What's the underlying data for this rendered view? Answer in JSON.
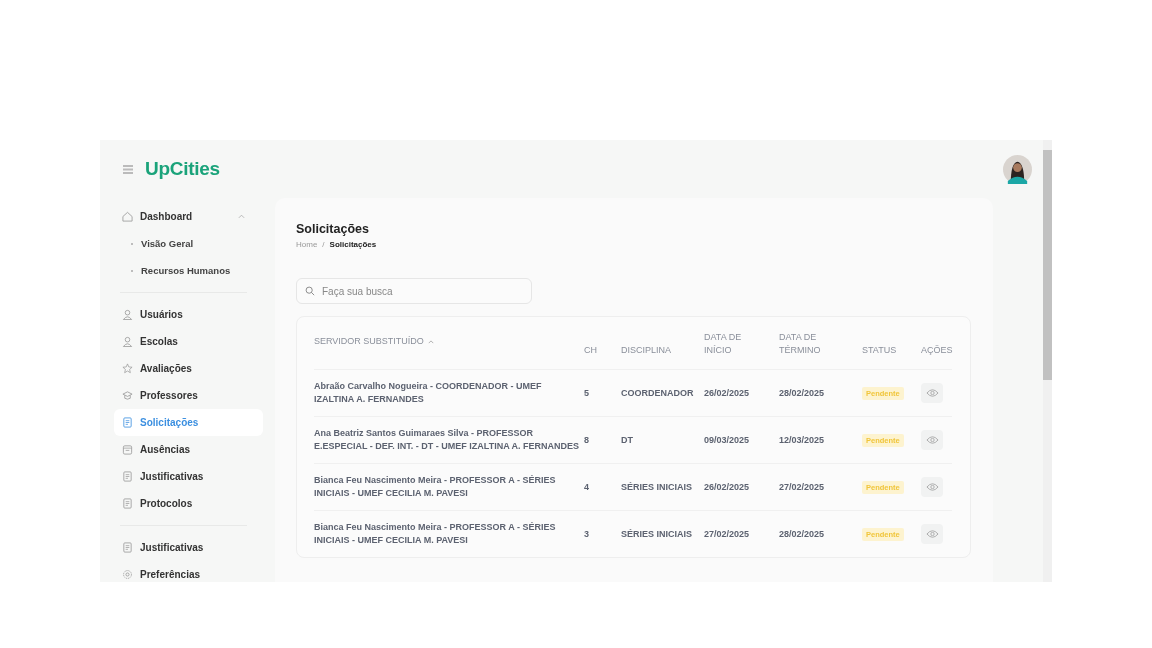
{
  "brand": "UpCities",
  "sidebar": {
    "sections": [
      [
        {
          "label": "Dashboard",
          "selected": false,
          "expanded": true,
          "children": [
            {
              "label": "Visão Geral",
              "selected": false
            },
            {
              "label": "Recursos Humanos",
              "selected": false
            }
          ]
        }
      ],
      [
        {
          "label": "Usuários",
          "selected": false
        },
        {
          "label": "Escolas",
          "selected": false
        },
        {
          "label": "Avaliações",
          "selected": false
        },
        {
          "label": "Professores",
          "selected": false
        },
        {
          "label": "Solicitações",
          "selected": true
        },
        {
          "label": "Ausências",
          "selected": false
        },
        {
          "label": "Justificativas",
          "selected": false
        },
        {
          "label": "Protocolos",
          "selected": false
        }
      ],
      [
        {
          "label": "Justificativas",
          "selected": false
        },
        {
          "label": "Preferências",
          "selected": false
        }
      ]
    ]
  },
  "page": {
    "title": "Solicitações",
    "breadcrumb": [
      "Home",
      "Solicitações"
    ],
    "breadcrumb_separator": "/"
  },
  "search": {
    "placeholder": "Faça sua busca"
  },
  "table": {
    "columns": [
      {
        "label": "SERVIDOR SUBSTITUÍDO",
        "sorted": true
      },
      {
        "label": "CH",
        "sorted": false
      },
      {
        "label": "DISCIPLINA",
        "sorted": false
      },
      {
        "label": "DATA DE INÍCIO",
        "sorted": false
      },
      {
        "label": "DATA DE TÉRMINO",
        "sorted": false
      },
      {
        "label": "STATUS",
        "sorted": false
      },
      {
        "label": "AÇÕES",
        "sorted": false
      }
    ],
    "rows": [
      {
        "servidor": "Abraão Carvalho Nogueira - COORDENADOR - UMEF IZALTINA A. FERNANDES",
        "ch": "5",
        "disciplina": "COORDENADOR",
        "inicio": "26/02/2025",
        "termino": "28/02/2025",
        "status": "Pendente"
      },
      {
        "servidor": "Ana Beatriz Santos Guimaraes Silva - PROFESSOR E.ESPECIAL - DEF. INT. - DT - UMEF IZALTINA A. FERNANDES",
        "ch": "8",
        "disciplina": "DT",
        "inicio": "09/03/2025",
        "termino": "12/03/2025",
        "status": "Pendente"
      },
      {
        "servidor": "Bianca Feu Nascimento Meira - PROFESSOR A - SÉRIES INICIAIS - UMEF CECILIA M. PAVESI",
        "ch": "4",
        "disciplina": "SÉRIES INICIAIS",
        "inicio": "26/02/2025",
        "termino": "27/02/2025",
        "status": "Pendente"
      },
      {
        "servidor": "Bianca Feu Nascimento Meira - PROFESSOR A - SÉRIES INICIAIS - UMEF CECILIA M. PAVESI",
        "ch": "3",
        "disciplina": "SÉRIES INICIAIS",
        "inicio": "27/02/2025",
        "termino": "28/02/2025",
        "status": "Pendente"
      }
    ]
  }
}
